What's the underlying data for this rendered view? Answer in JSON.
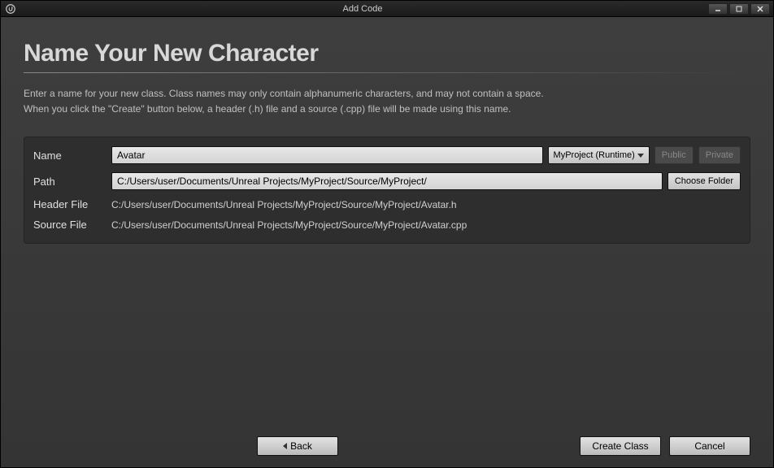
{
  "window": {
    "title": "Add Code"
  },
  "heading": "Name Your New Character",
  "description_line1": "Enter a name for your new class. Class names may only contain alphanumeric characters, and may not contain a space.",
  "description_line2": "When you click the \"Create\" button below, a header (.h) file and a source (.cpp) file will be made using this name.",
  "form": {
    "name_label": "Name",
    "name_value": "Avatar",
    "module_dropdown": "MyProject (Runtime)",
    "public_label": "Public",
    "private_label": "Private",
    "path_label": "Path",
    "path_value": "C:/Users/user/Documents/Unreal Projects/MyProject/Source/MyProject/",
    "choose_folder_label": "Choose Folder",
    "header_file_label": "Header File",
    "header_file_value": "C:/Users/user/Documents/Unreal Projects/MyProject/Source/MyProject/Avatar.h",
    "source_file_label": "Source File",
    "source_file_value": "C:/Users/user/Documents/Unreal Projects/MyProject/Source/MyProject/Avatar.cpp"
  },
  "buttons": {
    "back": "Back",
    "create": "Create Class",
    "cancel": "Cancel"
  }
}
